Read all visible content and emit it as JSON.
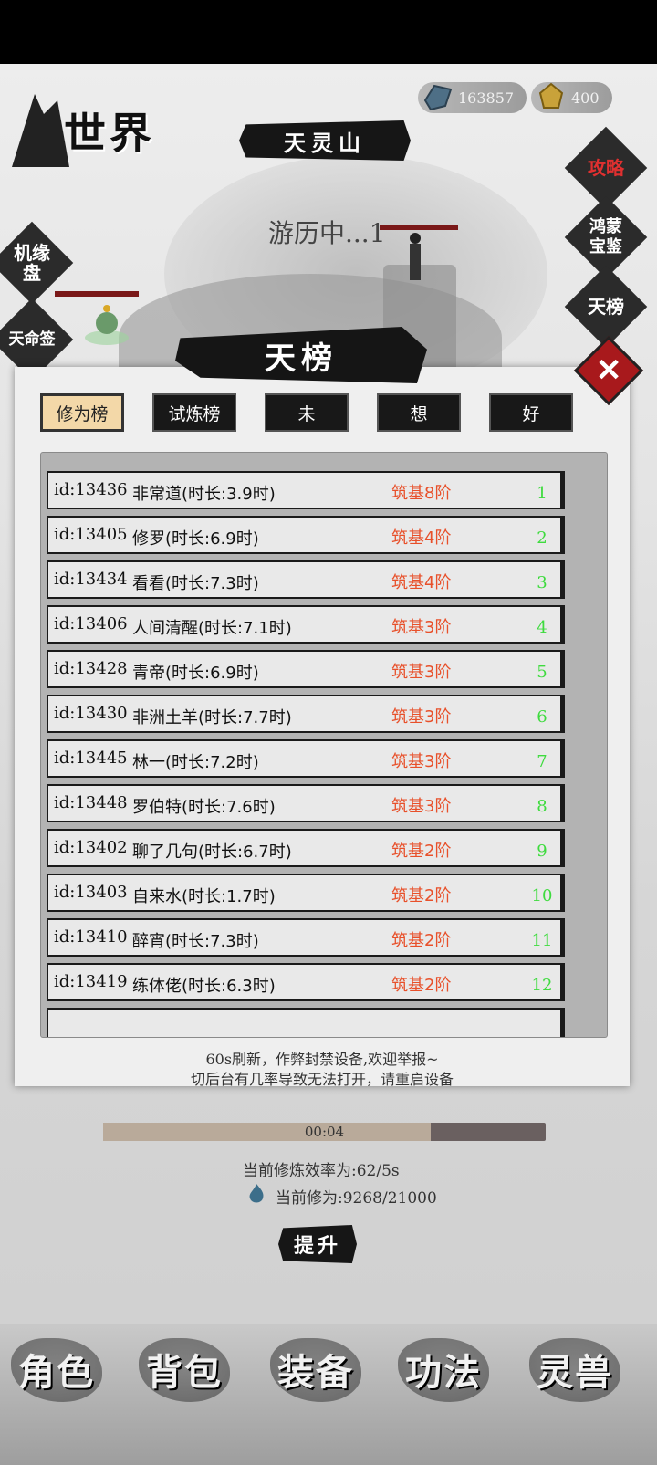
{
  "header": {
    "world_title": "世界",
    "location": "天灵山",
    "spirit_stones": "163857",
    "gold": "400"
  },
  "right_menu": [
    {
      "label": "攻略"
    },
    {
      "label": "鸿蒙宝鉴"
    },
    {
      "label": "天榜"
    }
  ],
  "left_menu": [
    {
      "label": "机缘盘"
    },
    {
      "label": "天命签"
    }
  ],
  "scene": {
    "status": "游历中...1"
  },
  "dialog": {
    "title": "天榜",
    "close": "✕",
    "tabs": [
      {
        "label": "修为榜",
        "active": true
      },
      {
        "label": "试炼榜",
        "active": false
      },
      {
        "label": "未",
        "active": false
      },
      {
        "label": "想",
        "active": false
      },
      {
        "label": "好",
        "active": false
      }
    ],
    "rows": [
      {
        "id": "id:13436",
        "name": "非常道(时长:3.9时)",
        "rank": "筑基8阶",
        "no": "1"
      },
      {
        "id": "id:13405",
        "name": "修罗(时长:6.9时)",
        "rank": "筑基4阶",
        "no": "2"
      },
      {
        "id": "id:13434",
        "name": "看看(时长:7.3时)",
        "rank": "筑基4阶",
        "no": "3"
      },
      {
        "id": "id:13406",
        "name": "人间清醒(时长:7.1时)",
        "rank": "筑基3阶",
        "no": "4"
      },
      {
        "id": "id:13428",
        "name": "青帝(时长:6.9时)",
        "rank": "筑基3阶",
        "no": "5"
      },
      {
        "id": "id:13430",
        "name": "非洲土羊(时长:7.7时)",
        "rank": "筑基3阶",
        "no": "6"
      },
      {
        "id": "id:13445",
        "name": "林一(时长:7.2时)",
        "rank": "筑基3阶",
        "no": "7"
      },
      {
        "id": "id:13448",
        "name": "罗伯特(时长:7.6时)",
        "rank": "筑基3阶",
        "no": "8"
      },
      {
        "id": "id:13402",
        "name": "聊了几句(时长:6.7时)",
        "rank": "筑基2阶",
        "no": "9"
      },
      {
        "id": "id:13403",
        "name": "自来水(时长:1.7时)",
        "rank": "筑基2阶",
        "no": "10"
      },
      {
        "id": "id:13410",
        "name": "醉宵(时长:7.3时)",
        "rank": "筑基2阶",
        "no": "11"
      },
      {
        "id": "id:13419",
        "name": "练体佬(时长:6.3时)",
        "rank": "筑基2阶",
        "no": "12"
      }
    ],
    "notice1": "60s刷新，作弊封禁设备,欢迎举报~",
    "notice2": "切后台有几率导致无法打开，请重启设备"
  },
  "cultivation": {
    "timer": "00:04",
    "progress_fraction": 0.74,
    "efficiency": "当前修炼效率为:62/5s",
    "current": "当前修为:9268/21000",
    "upgrade_label": "提升"
  },
  "bottom_nav": [
    {
      "label": "角色"
    },
    {
      "label": "背包"
    },
    {
      "label": "装备"
    },
    {
      "label": "功法"
    },
    {
      "label": "灵兽"
    }
  ],
  "colors": {
    "rank_text": "#e8502a",
    "rank_number": "#3edb3e",
    "close_red": "#a8191c",
    "active_tab": "#f3d8a8"
  }
}
